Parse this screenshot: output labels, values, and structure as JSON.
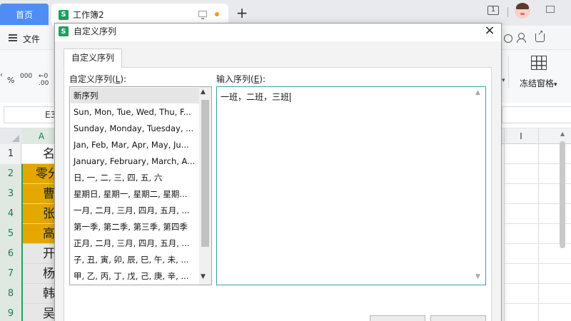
{
  "tabs": {
    "home": "首页",
    "doc_icon": "S",
    "doc_title": "工作簿2",
    "add": "+"
  },
  "window": {
    "badge": "1"
  },
  "menu": {
    "file": "文件"
  },
  "ribbon": {
    "pct": "%",
    "thousands": "000",
    "decimal_inc": "←0",
    "decimal_dec": ".00",
    "freeze_panes": "冻结窗格",
    "freeze_chevron": "▾",
    "chevron": "▾"
  },
  "formula_bar": {
    "cell_ref": "E3"
  },
  "sheet": {
    "col_a": "A",
    "col_i": "I",
    "rows": [
      {
        "num": "1",
        "value": "名",
        "style": "white"
      },
      {
        "num": "2",
        "value": "零分",
        "style": "orange"
      },
      {
        "num": "3",
        "value": "曹",
        "style": "orange"
      },
      {
        "num": "4",
        "value": "张",
        "style": "orange"
      },
      {
        "num": "5",
        "value": "高",
        "style": "orange"
      },
      {
        "num": "6",
        "value": "开",
        "style": "grey"
      },
      {
        "num": "7",
        "value": "杨",
        "style": "grey"
      },
      {
        "num": "8",
        "value": "韩",
        "style": "grey"
      },
      {
        "num": "9",
        "value": "吴",
        "style": "grey"
      }
    ]
  },
  "dialog": {
    "title": "自定义序列",
    "close": "×",
    "tab": "自定义序列",
    "list_label_prefix": "自定义序列(",
    "list_label_key": "L",
    "list_label_suffix": "):",
    "input_label_prefix": "输入序列(",
    "input_label_key": "E",
    "input_label_suffix": "):",
    "list_items": [
      "新序列",
      "Sun, Mon, Tue, Wed, Thu, F...",
      "Sunday, Monday, Tuesday, ...",
      "Jan, Feb, Mar, Apr, May, Ju...",
      "January, February, March, A...",
      "日, 一, 二, 三, 四, 五, 六",
      "星期日, 星期一, 星期二, 星期...",
      "一月, 二月, 三月, 四月, 五月, ...",
      "第一季, 第二季, 第三季, 第四季",
      "正月, 二月, 三月, 四月, 五月, ...",
      "子, 丑, 寅, 卯, 辰, 巳, 午, 未, ...",
      "甲, 乙, 丙, 丁, 戊, 己, 庚, 辛, ..."
    ],
    "selected_index": 0,
    "input_value": "一班，二班，三班"
  }
}
